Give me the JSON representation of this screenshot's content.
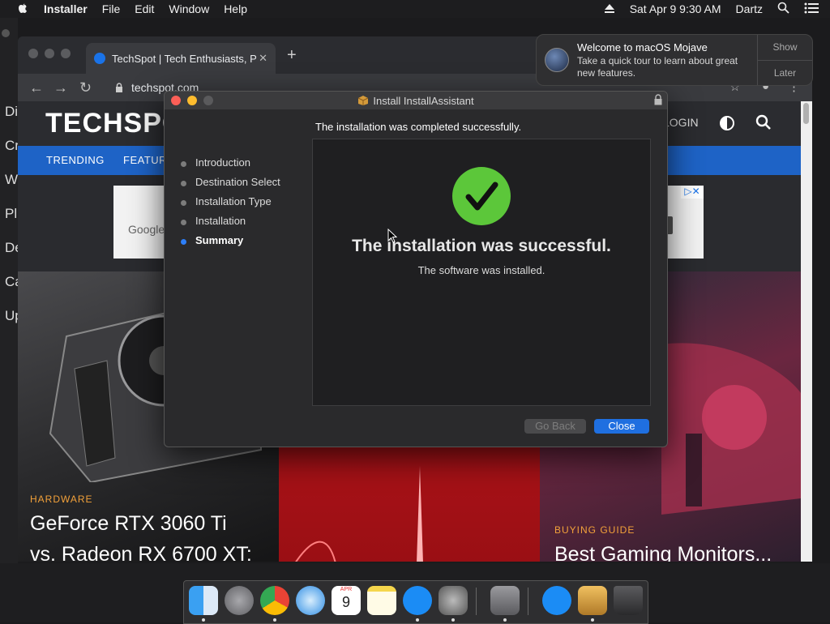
{
  "menubar": {
    "app_name": "Installer",
    "items": [
      "File",
      "Edit",
      "Window",
      "Help"
    ],
    "datetime": "Sat Apr 9  9:30 AM",
    "user": "Dartz"
  },
  "desktop_stubs": [
    "Di",
    "Cr",
    "W",
    "Pl",
    "De",
    "Ca",
    "Up"
  ],
  "browser": {
    "tab_title": "TechSpot | Tech Enthusiasts, P",
    "url": "techspot.com"
  },
  "techspot": {
    "logo": "TECHSPOT",
    "login": "LOGIN",
    "nav": [
      "TRENDING",
      "FEATURES"
    ],
    "ad_text": "Google",
    "articles": [
      {
        "kicker": "HARDWARE",
        "headline_line1": "GeForce RTX 3060 Ti",
        "headline_line2": "vs. Radeon RX 6700 XT:"
      },
      {
        "kicker": "BUYING GUIDE",
        "headline_line1": "Best Gaming Monitors..."
      }
    ]
  },
  "installer": {
    "title": "Install InstallAssistant",
    "heading": "The installation was completed successfully.",
    "steps": [
      {
        "label": "Introduction",
        "active": false
      },
      {
        "label": "Destination Select",
        "active": false
      },
      {
        "label": "Installation Type",
        "active": false
      },
      {
        "label": "Installation",
        "active": false
      },
      {
        "label": "Summary",
        "active": true
      }
    ],
    "success_title": "The installation was successful.",
    "success_subtitle": "The software was installed.",
    "go_back_label": "Go Back",
    "close_label": "Close"
  },
  "notification": {
    "title": "Welcome to macOS Mojave",
    "body": "Take a quick tour to learn about great new features.",
    "show_label": "Show",
    "later_label": "Later"
  },
  "dock": {
    "calendar_month": "APR",
    "calendar_day": "9"
  },
  "colors": {
    "accent": "#1f6fe0",
    "success": "#5cc73a",
    "techspot_nav": "#1e63c6"
  }
}
